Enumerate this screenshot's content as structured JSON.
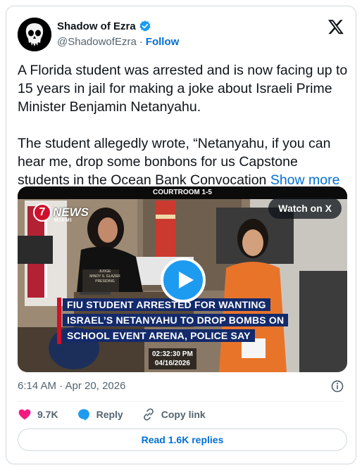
{
  "author": {
    "display_name": "Shadow of Ezra",
    "handle": "@ShadowofEzra",
    "separator": "·",
    "follow_label": "Follow"
  },
  "icons": {
    "avatar": "punisher-skull-avatar",
    "verified": "verified-badge-icon",
    "x_logo": "x-logo-icon",
    "info": "info-icon",
    "like": "heart-icon",
    "reply": "reply-icon",
    "copy_link": "link-icon",
    "play": "play-icon"
  },
  "tweet": {
    "paragraph1": "A Florida student was arrested and is now facing up to 15 years in jail for making a joke about Israeli Prime Minister Benjamin Netanyahu.",
    "paragraph2": "The student allegedly wrote, “Netanyahu, if you can hear me, drop some bonbons for us Capstone students in the Ocean Bank Convocation",
    "show_more": "Show more"
  },
  "media": {
    "top_label": "COURTROOM 1-5",
    "news_number": "7",
    "news_word": "NEWS",
    "news_city": "MIAMI",
    "judge_placard": [
      "JUDGE",
      "MINDY S. GLAZER",
      "PRESIDING"
    ],
    "watch_label": "Watch on X",
    "headline": "FIU STUDENT ARRESTED FOR WANTING ISRAEL’S NETANYAHU TO DROP BOMBS ON SCHOOL EVENT ARENA, POLICE SAY",
    "time_stamp": "02:32:30 PM",
    "date_stamp": "04/16/2026"
  },
  "meta": {
    "timestamp": "6:14 AM · Apr 20, 2026"
  },
  "actions": {
    "likes": "9.7K",
    "reply_label": "Reply",
    "copy_link_label": "Copy link"
  },
  "read_replies_label": "Read 1.6K replies",
  "colors": {
    "link_blue": "#006fd6",
    "verified_blue": "#1d9bf0",
    "heart_pink": "#f91880",
    "news_red": "#d0102b",
    "banner_navy": "#132a6b",
    "jumpsuit_orange": "#e8742a"
  }
}
